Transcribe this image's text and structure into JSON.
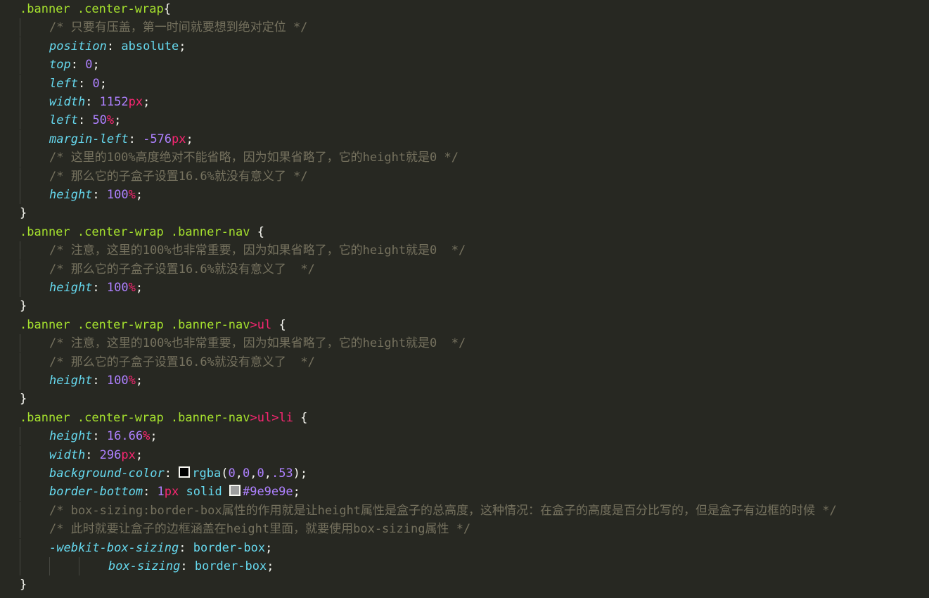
{
  "editor": {
    "colors": {
      "background": "#272822",
      "selector": "#a6e22e",
      "tag": "#f92672",
      "property": "#66d9ef",
      "number": "#ae81ff",
      "comment": "#75715e",
      "text": "#f8f8f2"
    },
    "lines": [
      {
        "indent": 0,
        "tokens": [
          [
            "sel",
            ".banner .center-wrap"
          ],
          [
            "pn",
            "{"
          ]
        ]
      },
      {
        "indent": 1,
        "tokens": [
          [
            "cm",
            "/* 只要有压盖，第一时间就要想到绝对定位 */"
          ]
        ]
      },
      {
        "indent": 1,
        "tokens": [
          [
            "prop",
            "position"
          ],
          [
            "pn",
            ": "
          ],
          [
            "kw",
            "absolute"
          ],
          [
            "pn",
            ";"
          ]
        ]
      },
      {
        "indent": 1,
        "tokens": [
          [
            "prop",
            "top"
          ],
          [
            "pn",
            ": "
          ],
          [
            "num",
            "0"
          ],
          [
            "pn",
            ";"
          ]
        ]
      },
      {
        "indent": 1,
        "tokens": [
          [
            "prop",
            "left"
          ],
          [
            "pn",
            ": "
          ],
          [
            "num",
            "0"
          ],
          [
            "pn",
            ";"
          ]
        ]
      },
      {
        "indent": 1,
        "tokens": [
          [
            "prop",
            "width"
          ],
          [
            "pn",
            ": "
          ],
          [
            "num",
            "1152"
          ],
          [
            "unit",
            "px"
          ],
          [
            "pn",
            ";"
          ]
        ]
      },
      {
        "indent": 1,
        "tokens": [
          [
            "prop",
            "left"
          ],
          [
            "pn",
            ": "
          ],
          [
            "num",
            "50"
          ],
          [
            "unit",
            "%"
          ],
          [
            "pn",
            ";"
          ]
        ]
      },
      {
        "indent": 1,
        "tokens": [
          [
            "prop",
            "margin-left"
          ],
          [
            "pn",
            ": "
          ],
          [
            "num",
            "-576"
          ],
          [
            "unit",
            "px"
          ],
          [
            "pn",
            ";"
          ]
        ]
      },
      {
        "indent": 1,
        "tokens": [
          [
            "cm",
            "/* 这里的100%高度绝对不能省略，因为如果省略了，它的height就是0 */"
          ]
        ]
      },
      {
        "indent": 1,
        "tokens": [
          [
            "cm",
            "/* 那么它的子盒子设置16.6%就没有意义了 */"
          ]
        ]
      },
      {
        "indent": 1,
        "tokens": [
          [
            "prop",
            "height"
          ],
          [
            "pn",
            ": "
          ],
          [
            "num",
            "100"
          ],
          [
            "unit",
            "%"
          ],
          [
            "pn",
            ";"
          ]
        ]
      },
      {
        "indent": 0,
        "tokens": [
          [
            "pn",
            "}"
          ]
        ]
      },
      {
        "indent": 0,
        "tokens": [
          [
            "sel",
            ".banner .center-wrap .banner-nav"
          ],
          [
            "pn",
            " {"
          ]
        ]
      },
      {
        "indent": 1,
        "tokens": [
          [
            "cm",
            "/* 注意，这里的100%也非常重要，因为如果省略了，它的height就是0  */"
          ]
        ]
      },
      {
        "indent": 1,
        "tokens": [
          [
            "cm",
            "/* 那么它的子盒子设置16.6%就没有意义了  */"
          ]
        ]
      },
      {
        "indent": 1,
        "tokens": [
          [
            "prop",
            "height"
          ],
          [
            "pn",
            ": "
          ],
          [
            "num",
            "100"
          ],
          [
            "unit",
            "%"
          ],
          [
            "pn",
            ";"
          ]
        ]
      },
      {
        "indent": 0,
        "tokens": [
          [
            "pn",
            "}"
          ]
        ]
      },
      {
        "indent": 0,
        "tokens": [
          [
            "sel",
            ".banner .center-wrap .banner-nav"
          ],
          [
            "tag",
            ">ul"
          ],
          [
            "pn",
            " {"
          ]
        ]
      },
      {
        "indent": 1,
        "tokens": [
          [
            "cm",
            "/* 注意，这里的100%也非常重要，因为如果省略了，它的height就是0  */"
          ]
        ]
      },
      {
        "indent": 1,
        "tokens": [
          [
            "cm",
            "/* 那么它的子盒子设置16.6%就没有意义了  */"
          ]
        ]
      },
      {
        "indent": 1,
        "tokens": [
          [
            "prop",
            "height"
          ],
          [
            "pn",
            ": "
          ],
          [
            "num",
            "100"
          ],
          [
            "unit",
            "%"
          ],
          [
            "pn",
            ";"
          ]
        ]
      },
      {
        "indent": 0,
        "tokens": [
          [
            "pn",
            "}"
          ]
        ]
      },
      {
        "indent": 0,
        "tokens": [
          [
            "sel",
            ".banner .center-wrap .banner-nav"
          ],
          [
            "tag",
            ">ul>li"
          ],
          [
            "pn",
            " {"
          ]
        ]
      },
      {
        "indent": 1,
        "tokens": [
          [
            "prop",
            "height"
          ],
          [
            "pn",
            ": "
          ],
          [
            "num",
            "16.66"
          ],
          [
            "unit",
            "%"
          ],
          [
            "pn",
            ";"
          ]
        ]
      },
      {
        "indent": 1,
        "tokens": [
          [
            "prop",
            "width"
          ],
          [
            "pn",
            ": "
          ],
          [
            "num",
            "296"
          ],
          [
            "unit",
            "px"
          ],
          [
            "pn",
            ";"
          ]
        ]
      },
      {
        "indent": 1,
        "tokens": [
          [
            "prop",
            "background-color"
          ],
          [
            "pn",
            ": "
          ],
          [
            "swatch",
            "#000000"
          ],
          [
            "kw",
            "rgba"
          ],
          [
            "pn",
            "("
          ],
          [
            "num",
            "0"
          ],
          [
            "pn",
            ","
          ],
          [
            "num",
            "0"
          ],
          [
            "pn",
            ","
          ],
          [
            "num",
            "0"
          ],
          [
            "pn",
            ","
          ],
          [
            "num",
            ".53"
          ],
          [
            "pn",
            ");"
          ]
        ]
      },
      {
        "indent": 1,
        "tokens": [
          [
            "prop",
            "border-bottom"
          ],
          [
            "pn",
            ": "
          ],
          [
            "num",
            "1"
          ],
          [
            "unit",
            "px"
          ],
          [
            "pn",
            " "
          ],
          [
            "kw",
            "solid"
          ],
          [
            "pn",
            " "
          ],
          [
            "swatch",
            "#9e9e9e"
          ],
          [
            "num",
            "#9e9e9e"
          ],
          [
            "pn",
            ";"
          ]
        ]
      },
      {
        "indent": 1,
        "tokens": [
          [
            "cm",
            "/* box-sizing:border-box属性的作用就是让height属性是盒子的总高度，这种情况：在盒子的高度是百分比写的，但是盒子有边框的时候 */"
          ]
        ]
      },
      {
        "indent": 1,
        "tokens": [
          [
            "cm",
            "/* 此时就要让盒子的边框涵盖在height里面，就要使用box-sizing属性 */"
          ]
        ]
      },
      {
        "indent": 1,
        "tokens": [
          [
            "prop",
            "-webkit-box-sizing"
          ],
          [
            "pn",
            ": "
          ],
          [
            "kw",
            "border-box"
          ],
          [
            "pn",
            ";"
          ]
        ]
      },
      {
        "indent": 3,
        "tokens": [
          [
            "prop",
            "box-sizing"
          ],
          [
            "pn",
            ": "
          ],
          [
            "kw",
            "border-box"
          ],
          [
            "pn",
            ";"
          ]
        ]
      },
      {
        "indent": 0,
        "tokens": [
          [
            "pn",
            "}"
          ]
        ]
      }
    ]
  }
}
